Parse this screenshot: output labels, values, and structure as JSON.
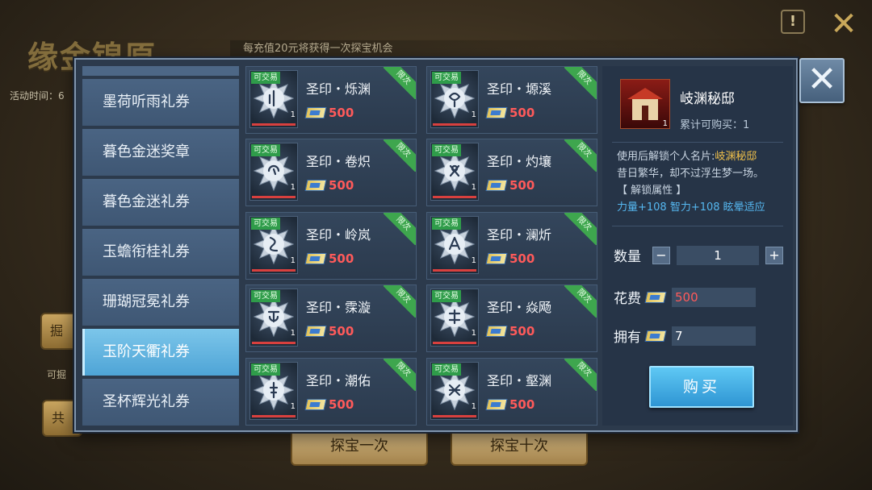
{
  "background": {
    "event_title": "缘金锦原",
    "event_time_label": "活动时间：6",
    "banner": "每充值20元将获得一次探宝机会",
    "left_btn_1": "掘",
    "left_btn_2": "共",
    "left_hint": "可掘",
    "explore_once": "探宝一次",
    "explore_ten": "探宝十次",
    "info_icon": "exclamation-icon",
    "close_icon": "close-icon"
  },
  "sidebar": {
    "items": [
      {
        "label": "墨荷听雨礼券",
        "active": false
      },
      {
        "label": "暮色金迷奖章",
        "active": false
      },
      {
        "label": "暮色金迷礼券",
        "active": false
      },
      {
        "label": "玉蟾衔桂礼券",
        "active": false
      },
      {
        "label": "珊瑚冠冕礼券",
        "active": false
      },
      {
        "label": "玉阶天衢礼券",
        "active": true
      },
      {
        "label": "圣杯辉光礼券",
        "active": false
      }
    ]
  },
  "items": [
    {
      "name": "圣印・烁渊",
      "price": "500",
      "trade_tag": "可交易",
      "limit_tag": "限次",
      "qty": "1"
    },
    {
      "name": "圣印・塬溪",
      "price": "500",
      "trade_tag": "可交易",
      "limit_tag": "限次",
      "qty": "1"
    },
    {
      "name": "圣印・卷炽",
      "price": "500",
      "trade_tag": "可交易",
      "limit_tag": "限次",
      "qty": "1"
    },
    {
      "name": "圣印・灼壤",
      "price": "500",
      "trade_tag": "可交易",
      "limit_tag": "限次",
      "qty": "1"
    },
    {
      "name": "圣印・岭岚",
      "price": "500",
      "trade_tag": "可交易",
      "limit_tag": "限次",
      "qty": "1"
    },
    {
      "name": "圣印・澜炘",
      "price": "500",
      "trade_tag": "可交易",
      "limit_tag": "限次",
      "qty": "1"
    },
    {
      "name": "圣印・霂漩",
      "price": "500",
      "trade_tag": "可交易",
      "limit_tag": "限次",
      "qty": "1"
    },
    {
      "name": "圣印・焱飏",
      "price": "500",
      "trade_tag": "可交易",
      "limit_tag": "限次",
      "qty": "1"
    },
    {
      "name": "圣印・潮佑",
      "price": "500",
      "trade_tag": "可交易",
      "limit_tag": "限次",
      "qty": "1"
    },
    {
      "name": "圣印・壑渊",
      "price": "500",
      "trade_tag": "可交易",
      "limit_tag": "限次",
      "qty": "1"
    }
  ],
  "detail": {
    "name": "岐渊秘邸",
    "purchase_limit": "累计可购买：1",
    "thumb_qty": "1",
    "desc_prefix": "使用后解锁个人名片:",
    "desc_highlight": "岐渊秘邸",
    "flavor": "昔日繁华，却不过浮生梦一场。",
    "attr_title": "【 解锁属性 】",
    "attr_values": "力量+108 智力+108 眩晕适应",
    "qty_label": "数量",
    "qty_value": "1",
    "minus": "−",
    "plus": "+",
    "cost_label": "花费",
    "cost_value": "500",
    "own_label": "拥有",
    "own_value": "7",
    "buy_label": "购买"
  },
  "colors": {
    "accent": "#4ea4d6",
    "price": "#ff5a5a",
    "highlight": "#f0c04a",
    "attr": "#55b7f0",
    "trade_tag": "#2f9c4a"
  }
}
